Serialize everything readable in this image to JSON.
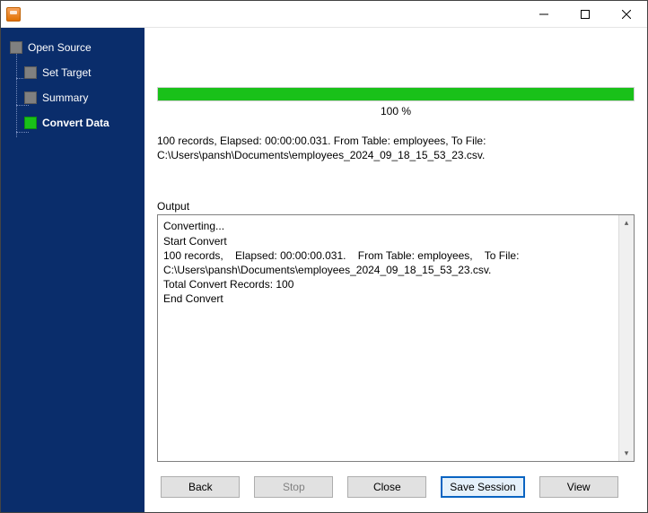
{
  "sidebar": {
    "items": [
      {
        "label": "Open Source"
      },
      {
        "label": "Set Target"
      },
      {
        "label": "Summary"
      },
      {
        "label": "Convert Data"
      }
    ]
  },
  "progress": {
    "percent_text": "100 %"
  },
  "summary_text": "100 records,    Elapsed: 00:00:00.031.    From Table: employees,    To File: C:\\Users\\pansh\\Documents\\employees_2024_09_18_15_53_23.csv.",
  "output": {
    "label": "Output",
    "text": "Converting...\nStart Convert\n100 records,    Elapsed: 00:00:00.031.    From Table: employees,    To File: C:\\Users\\pansh\\Documents\\employees_2024_09_18_15_53_23.csv.\nTotal Convert Records: 100\nEnd Convert"
  },
  "buttons": {
    "back": "Back",
    "stop": "Stop",
    "close": "Close",
    "save_session": "Save Session",
    "view": "View"
  }
}
